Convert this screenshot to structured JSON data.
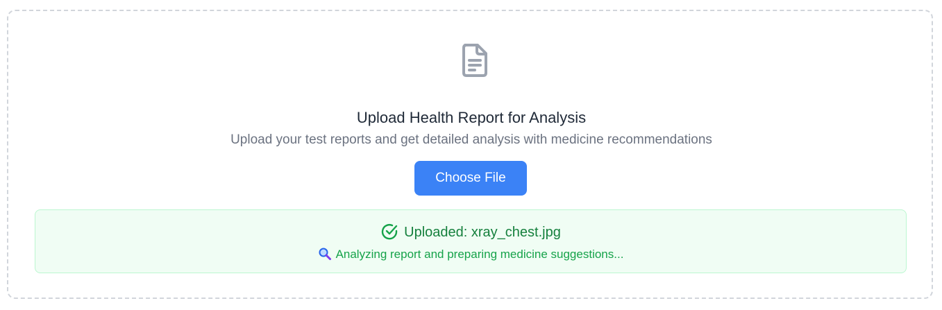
{
  "upload": {
    "icon": "document-icon",
    "title": "Upload Health Report for Analysis",
    "subtitle": "Upload your test reports and get detailed analysis with medicine recommendations",
    "button_label": "Choose File",
    "accent_color": "#3b82f6"
  },
  "status": {
    "check_icon": "check-circle-icon",
    "uploaded_label": "Uploaded: xray_chest.jpg",
    "analyzing_icon": "magnifying-glass-icon",
    "analyzing_text": "Analyzing report and preparing medicine suggestions...",
    "success_color": "#15803d"
  }
}
